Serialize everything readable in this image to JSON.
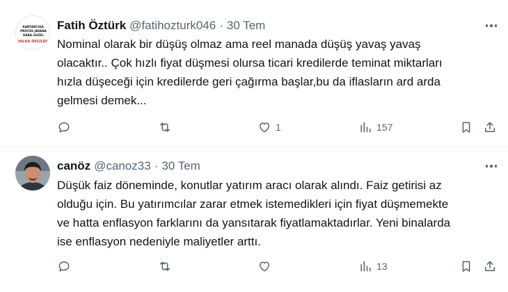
{
  "tweets": [
    {
      "author_name": "Fatih Öztürk",
      "handle": "@fatihozturk046",
      "separator": "·",
      "date": "30 Tem",
      "avatar_text": [
        "KANTARCIGIL",
        "PROCES JAVANA",
        "KARA GUZEL",
        "HALKA DEGILDIR"
      ],
      "text_lines": [
        "Nominal olarak bir düşüş olmaz ama reel manada düşüş yavaş yavaş",
        "olacaktır.. Çok hızlı fiyat düşmesi olursa ticari kredilerde teminat miktarları",
        "hızla düşeceği için kredilerde geri çağırma başlar,bu da iflasların ard arda",
        "gelmesi demek..."
      ],
      "actions": {
        "replies": "",
        "reposts": "",
        "likes": "1",
        "views": "157"
      },
      "icons": [
        "reply-icon",
        "repost-icon",
        "like-icon",
        "views-icon",
        "bookmark-icon",
        "share-icon",
        "more-icon"
      ]
    },
    {
      "author_name": "canöz",
      "handle": "@canoz33",
      "separator": "·",
      "date": "30 Tem",
      "text_lines": [
        "Düşük faiz döneminde, konutlar yatırım aracı olarak alındı. Faiz getirisi az",
        "olduğu için. Bu yatırımcılar zarar etmek istemedikleri için fiyat düşmemekte",
        "ve hatta enflasyon farklarını da yansıtarak fiyatlamaktadırlar. Yeni binalarda",
        "ise enflasyon nedeniyle maliyetler arttı."
      ],
      "actions": {
        "replies": "",
        "reposts": "",
        "likes": "",
        "views": "13"
      },
      "icons": [
        "reply-icon",
        "repost-icon",
        "like-icon",
        "views-icon",
        "bookmark-icon",
        "share-icon",
        "more-icon"
      ]
    }
  ],
  "colors": {
    "text": "#0f1419",
    "secondary": "#536471",
    "divider": "#eff3f4"
  }
}
